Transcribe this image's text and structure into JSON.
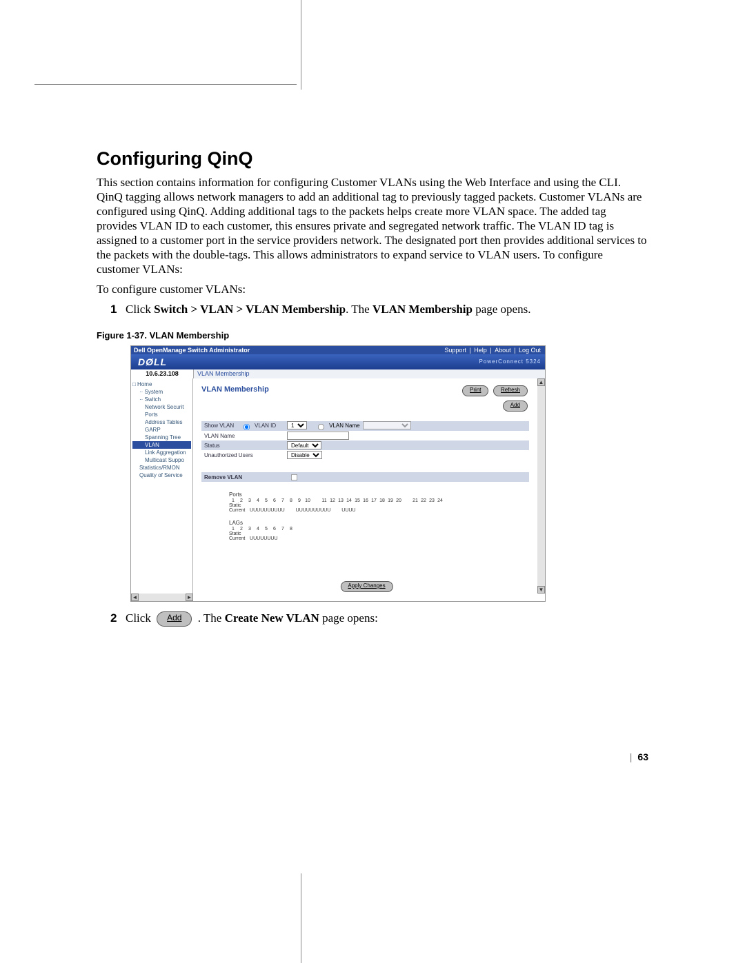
{
  "heading": "Configuring QinQ",
  "intro": "This section contains information for configuring Customer VLANs using the Web Interface and using the CLI. QinQ tagging allows network managers to add an additional tag to previously tagged packets. Customer VLANs are configured using QinQ. Adding additional tags to the packets helps create more VLAN space. The added tag provides VLAN ID to each customer, this ensures private and segregated network traffic. The VLAN ID tag is assigned to a customer port in the service providers network. The designated port then provides additional services to the packets with the double-tags. This allows administrators to expand service to VLAN users. To configure customer VLANs:",
  "pre_steps": "To configure customer VLANs:",
  "step1": {
    "num": "1",
    "prefix": "Click ",
    "path": "Switch > VLAN > VLAN Membership",
    "mid": ". The ",
    "page": "VLAN Membership",
    "suffix": " page opens."
  },
  "fig_caption": "Figure 1-37.    VLAN Membership",
  "step2": {
    "num": "2",
    "prefix": "Click ",
    "btn": "Add",
    "mid": ". The ",
    "page": "Create New VLAN",
    "suffix": " page opens:"
  },
  "page_number": "63",
  "shot": {
    "ribbon_title": "Dell OpenManage Switch Administrator",
    "ribbon_links": [
      "Support",
      "Help",
      "About",
      "Log Out"
    ],
    "brand": "DØLL",
    "product": "PowerConnect 5324",
    "ip": "10.6.23.108",
    "crumb": "VLAN Membership",
    "tree": [
      {
        "cls": "",
        "t": "□ Home"
      },
      {
        "cls": "l2",
        "t": "·· System"
      },
      {
        "cls": "l2",
        "t": "·· Switch"
      },
      {
        "cls": "l3",
        "t": "Network Securit"
      },
      {
        "cls": "l3",
        "t": "Ports"
      },
      {
        "cls": "l3",
        "t": "Address Tables"
      },
      {
        "cls": "l3",
        "t": "GARP"
      },
      {
        "cls": "l3",
        "t": "Spanning Tree"
      },
      {
        "cls": "sel",
        "t": "VLAN"
      },
      {
        "cls": "l3",
        "t": "Link Aggregation"
      },
      {
        "cls": "l3",
        "t": "Multicast Suppo"
      },
      {
        "cls": "l2",
        "t": "Statistics/RMON"
      },
      {
        "cls": "l2",
        "t": "Quality of Service"
      }
    ],
    "panel_title": "VLAN Membership",
    "buttons": {
      "print": "Print",
      "refresh": "Refresh",
      "add": "Add"
    },
    "fields": {
      "show_vlan": "Show VLAN",
      "vlan_id": "VLAN ID",
      "vlan_id_val": "1",
      "vlan_name": "VLAN Name",
      "vlan_name_lab": "VLAN Name",
      "vlan_name_val": "",
      "status": "Status",
      "status_val": "Default",
      "unauth": "Unauthorized Users",
      "unauth_val": "Disable",
      "remove": "Remove VLAN"
    },
    "ports": {
      "title": "Ports",
      "cols1": [
        "1",
        "2",
        "3",
        "4",
        "5",
        "6",
        "7",
        "8",
        "9",
        "10"
      ],
      "cols2": [
        "11",
        "12",
        "13",
        "14",
        "15",
        "16",
        "17",
        "18",
        "19",
        "20"
      ],
      "cols3": [
        "21",
        "22",
        "23",
        "24"
      ],
      "static": "Static",
      "current": "Current",
      "u": "U"
    },
    "lags": {
      "title": "LAGs",
      "cols": [
        "1",
        "2",
        "3",
        "4",
        "5",
        "6",
        "7",
        "8"
      ]
    },
    "apply": "Apply Changes"
  }
}
